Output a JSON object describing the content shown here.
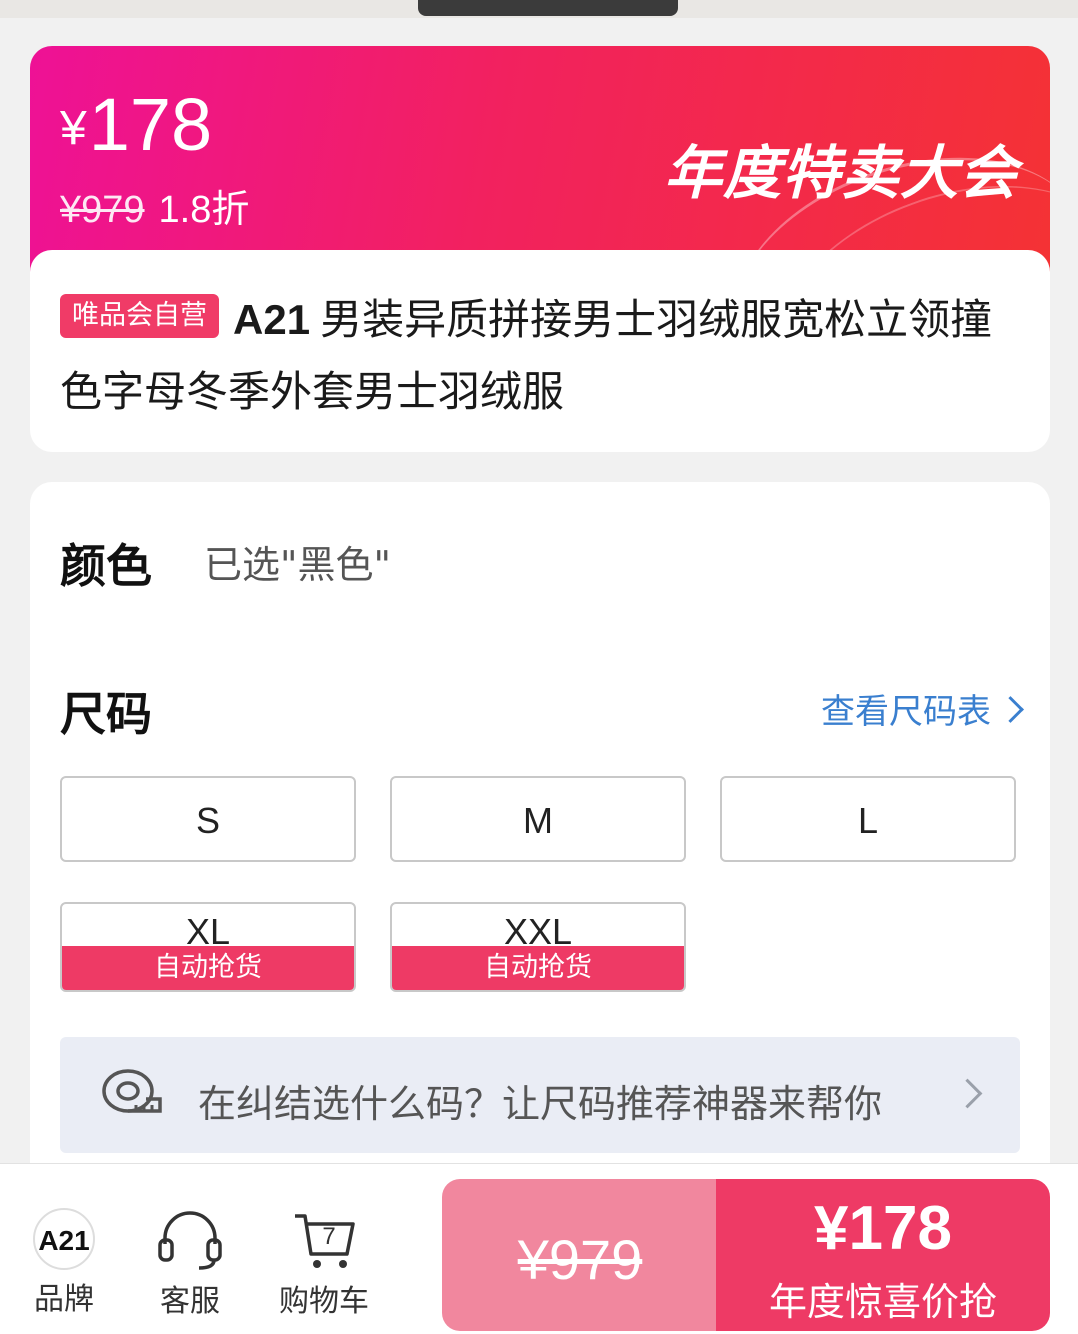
{
  "banner": {
    "sale_price": "178",
    "currency": "¥",
    "original_price": "¥979",
    "discount": "1.8折",
    "event_title": "年度特卖大会"
  },
  "product": {
    "self_operated_tag": "唯品会自营",
    "brand_model": "A21",
    "title": "男装异质拼接男士羽绒服宽松立领撞色字母冬季外套男士羽绒服"
  },
  "options": {
    "color_label": "颜色",
    "color_selected": "已选\"黑色\"",
    "size_label": "尺码",
    "size_chart_link": "查看尺码表",
    "sizes": [
      {
        "label": "S"
      },
      {
        "label": "M"
      },
      {
        "label": "L"
      },
      {
        "label": "XL",
        "auto": "自动抢货"
      },
      {
        "label": "XXL",
        "auto": "自动抢货"
      }
    ],
    "recommend_text": "在纠结选什么码？让尺码推荐神器来帮你"
  },
  "bottom_nav": {
    "brand_logo": "A21",
    "brand": "品牌",
    "service": "客服",
    "cart": "购物车",
    "cart_count": "7"
  },
  "buy": {
    "original_price": "¥979",
    "price": "¥178",
    "cta": "年度惊喜价抢"
  },
  "colors": {
    "banner_start": "#ee1196",
    "banner_end": "#f43234",
    "accent": "#ee3a65",
    "link": "#3a7fcf"
  }
}
